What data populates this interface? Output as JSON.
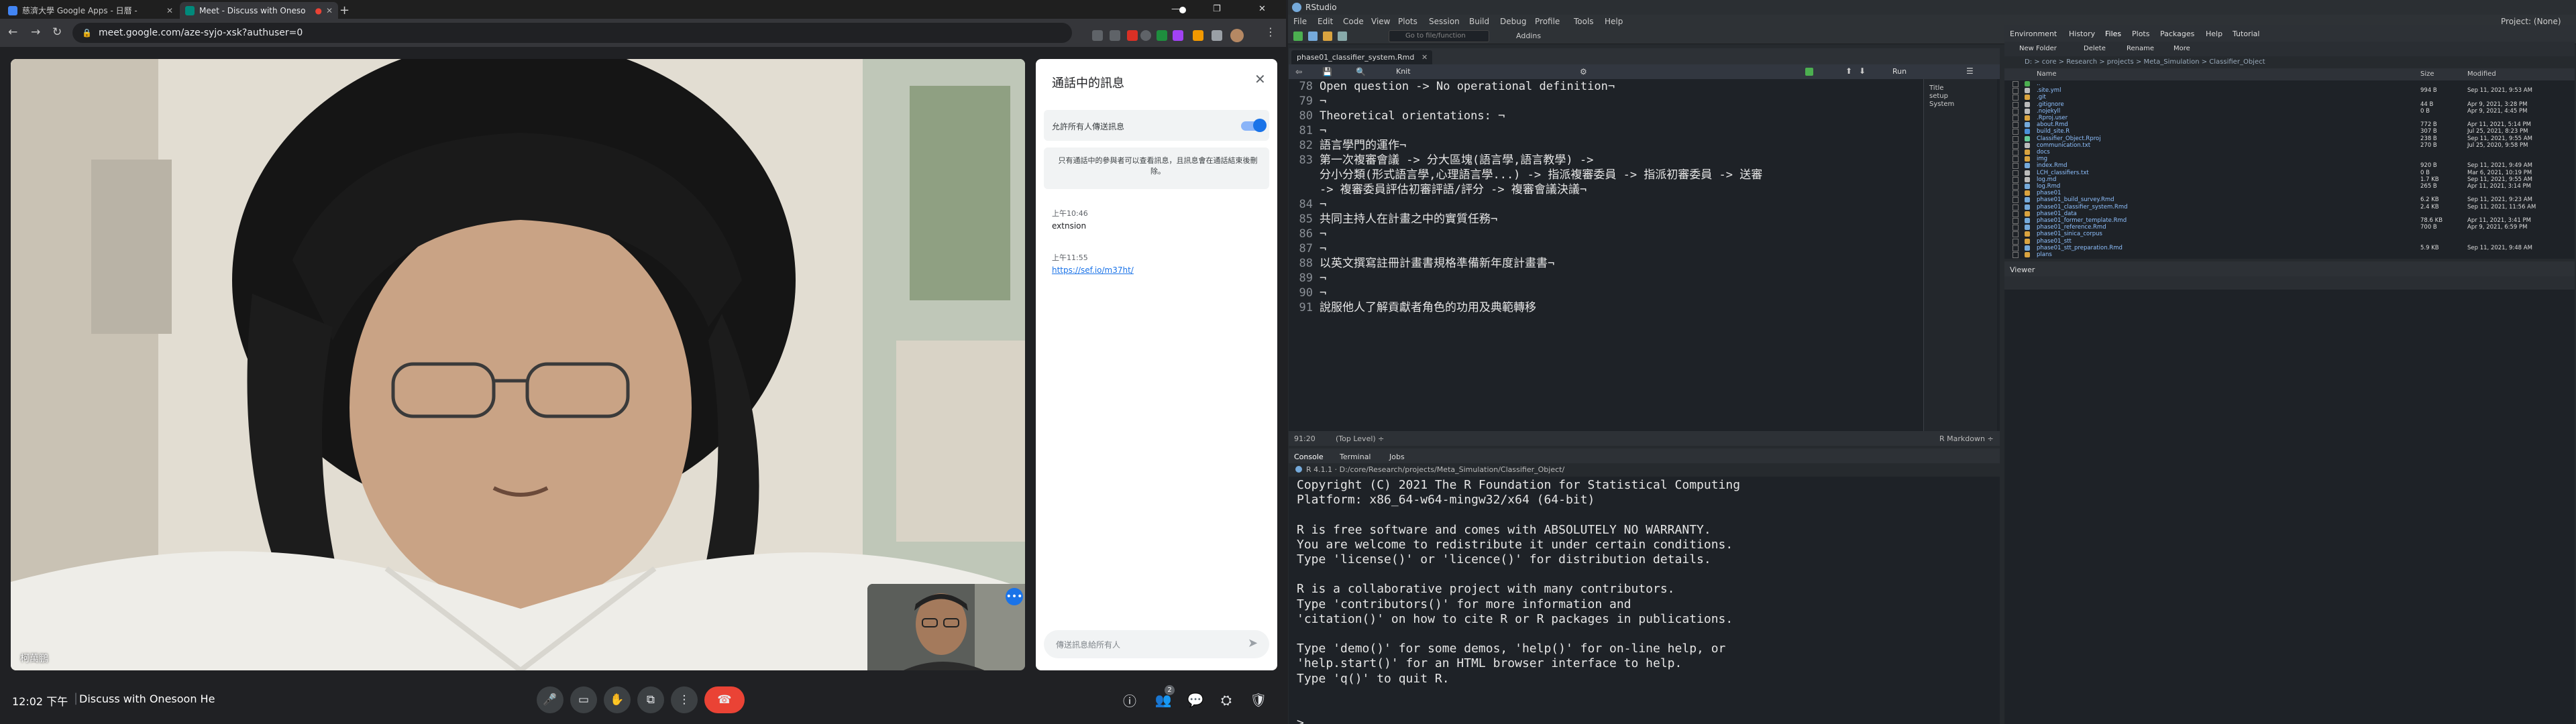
{
  "chrome": {
    "tabs": [
      {
        "title": "慈濟大學 Google Apps - 日曆 -",
        "favicon": "calendar-icon",
        "active": false
      },
      {
        "title": "Meet - Discuss with Oneso",
        "favicon": "meet-icon",
        "active": true
      },
      {
        "title": "+",
        "favicon": "",
        "active": false
      }
    ],
    "url": "meet.google.com/aze-syjo-xsk?authuser=0",
    "window_controls": [
      "—",
      "❐",
      "✕"
    ]
  },
  "meet": {
    "main_speaker_name": "柯萬鵬",
    "time": "12:02 下午",
    "meeting_title": "Discuss with Onesoon He",
    "participant_badge": "2",
    "chat": {
      "title": "通話中的訊息",
      "toggle_label": "允許所有人傳送訊息",
      "toggle_on": true,
      "notice": "只有通話中的參與者可以查看訊息，且訊息會在通話結束後刪除。",
      "messages": [
        {
          "time": "上午10:46",
          "text": "extnsion"
        },
        {
          "time": "上午11:55",
          "text": "https://sef.io/m37ht/"
        }
      ],
      "input_placeholder": "傳送訊息給所有人"
    }
  },
  "rstudio": {
    "title": "RStudio",
    "menu": [
      "File",
      "Edit",
      "Code",
      "View",
      "Plots",
      "Session",
      "Build",
      "Debug",
      "Profile",
      "Tools",
      "Help"
    ],
    "project": "Project: (None)",
    "toolbar_goto": "Go to file/function",
    "toolbar_addins": "Addins",
    "editor": {
      "tab": "phase01_classifier_system.Rmd",
      "knit": "Knit",
      "run": "Run",
      "lines": [
        {
          "num": "78",
          "text": "Open question -> No operational definition¬"
        },
        {
          "num": "79",
          "text": "¬"
        },
        {
          "num": "80",
          "text": "Theoretical orientations: ¬"
        },
        {
          "num": "81",
          "text": "¬"
        },
        {
          "num": "82",
          "text": "語言學門的運作¬"
        },
        {
          "num": "83",
          "text": "第一次複審會議 -> 分大區塊(語言學,語言教學) ->"
        },
        {
          "num": "",
          "text": "分小分類(形式語言學,心理語言學...) -> 指派複審委員 -> 指派初審委員 -> 送審"
        },
        {
          "num": "",
          "text": "-> 複審委員評估初審評語/評分 -> 複審會議決議¬"
        },
        {
          "num": "84",
          "text": "¬"
        },
        {
          "num": "85",
          "text": "共同主持人在計畫之中的實質任務¬"
        },
        {
          "num": "86",
          "text": "¬"
        },
        {
          "num": "87",
          "text": "¬"
        },
        {
          "num": "88",
          "text": "以英文撰寫註冊計畫書規格準備新年度計畫書¬"
        },
        {
          "num": "89",
          "text": "¬"
        },
        {
          "num": "90",
          "text": "¬"
        },
        {
          "num": "91",
          "text": "說服他人了解貢獻者角色的功用及典範轉移"
        }
      ],
      "outline": [
        "Title",
        "setup",
        "System"
      ],
      "status_pos": "91:20",
      "status_level": "(Top Level) ÷",
      "status_type": "R Markdown ÷"
    },
    "console": {
      "tabs": [
        "Console",
        "Terminal",
        "Jobs"
      ],
      "path": "R 4.1.1 · D:/core/Research/projects/Meta_Simulation/Classifier_Object/",
      "text": "Copyright (C) 2021 The R Foundation for Statistical Computing\nPlatform: x86_64-w64-mingw32/x64 (64-bit)\n\nR is free software and comes with ABSOLUTELY NO WARRANTY.\nYou are welcome to redistribute it under certain conditions.\nType 'license()' or 'licence()' for distribution details.\n\nR is a collaborative project with many contributors.\nType 'contributors()' for more information and\n'citation()' on how to cite R or R packages in publications.\n\nType 'demo()' for some demos, 'help()' for on-line help, or\n'help.start()' for an HTML browser interface to help.\nType 'q()' to quit R.\n\n\n> "
    },
    "files": {
      "tabs": [
        "Environment",
        "History",
        "Files",
        "Plots",
        "Packages",
        "Help",
        "Tutorial"
      ],
      "toolbar": [
        "New Folder",
        "Delete",
        "Rename",
        "More"
      ],
      "path": "D: > core > Research > projects > Meta_Simulation > Classifier_Object",
      "columns": [
        "Name",
        "Size",
        "Modified"
      ],
      "rows": [
        {
          "name": "..",
          "size": "",
          "modified": "",
          "kind": "up"
        },
        {
          "name": ".site.yml",
          "size": "994 B",
          "modified": "Sep 11, 2021, 9:53 AM",
          "kind": "file"
        },
        {
          "name": ".git",
          "size": "",
          "modified": "",
          "kind": "folder"
        },
        {
          "name": ".gitignore",
          "size": "44 B",
          "modified": "Apr 9, 2021, 3:28 PM",
          "kind": "file"
        },
        {
          "name": ".nojekyll",
          "size": "0 B",
          "modified": "Apr 9, 2021, 4:45 PM",
          "kind": "file"
        },
        {
          "name": ".Rproj.user",
          "size": "",
          "modified": "",
          "kind": "folder"
        },
        {
          "name": "about.Rmd",
          "size": "772 B",
          "modified": "Apr 11, 2021, 5:14 PM",
          "kind": "rmd"
        },
        {
          "name": "build_site.R",
          "size": "307 B",
          "modified": "Jul 25, 2021, 8:23 PM",
          "kind": "r"
        },
        {
          "name": "Classifier_Object.Rproj",
          "size": "238 B",
          "modified": "Sep 11, 2021, 9:55 AM",
          "kind": "proj"
        },
        {
          "name": "communication.txt",
          "size": "270 B",
          "modified": "Jul 25, 2020, 9:58 PM",
          "kind": "file"
        },
        {
          "name": "docs",
          "size": "",
          "modified": "",
          "kind": "folder"
        },
        {
          "name": "img",
          "size": "",
          "modified": "",
          "kind": "folder"
        },
        {
          "name": "index.Rmd",
          "size": "920 B",
          "modified": "Sep 11, 2021, 9:49 AM",
          "kind": "rmd"
        },
        {
          "name": "LCH_classifiers.txt",
          "size": "0 B",
          "modified": "Mar 6, 2021, 10:19 PM",
          "kind": "file"
        },
        {
          "name": "log.md",
          "size": "1.7 KB",
          "modified": "Sep 11, 2021, 9:55 AM",
          "kind": "file"
        },
        {
          "name": "log.Rmd",
          "size": "265 B",
          "modified": "Apr 11, 2021, 3:14 PM",
          "kind": "rmd"
        },
        {
          "name": "phase01",
          "size": "",
          "modified": "",
          "kind": "folder"
        },
        {
          "name": "phase01_build_survey.Rmd",
          "size": "6.2 KB",
          "modified": "Sep 11, 2021, 9:23 AM",
          "kind": "rmd"
        },
        {
          "name": "phase01_classifier_system.Rmd",
          "size": "2.4 KB",
          "modified": "Sep 11, 2021, 11:56 AM",
          "kind": "rmd"
        },
        {
          "name": "phase01_data",
          "size": "",
          "modified": "",
          "kind": "folder"
        },
        {
          "name": "phase01_former_template.Rmd",
          "size": "78.6 KB",
          "modified": "Apr 11, 2021, 3:41 PM",
          "kind": "rmd"
        },
        {
          "name": "phase01_reference.Rmd",
          "size": "700 B",
          "modified": "Apr 9, 2021, 6:59 PM",
          "kind": "rmd"
        },
        {
          "name": "phase01_sinica_corpus",
          "size": "",
          "modified": "",
          "kind": "folder"
        },
        {
          "name": "phase01_stt",
          "size": "",
          "modified": "",
          "kind": "folder"
        },
        {
          "name": "phase01_stt_preparation.Rmd",
          "size": "5.9 KB",
          "modified": "Sep 11, 2021, 9:48 AM",
          "kind": "rmd"
        },
        {
          "name": "plans",
          "size": "",
          "modified": "",
          "kind": "folder"
        }
      ]
    },
    "viewer_tab": "Viewer"
  },
  "colors": {
    "meet_bg": "#202124",
    "end_call": "#ea4335",
    "toggle_blue": "#1a73e8",
    "rstudio_bg": "#1e2227",
    "folder": "#d9a33f"
  }
}
